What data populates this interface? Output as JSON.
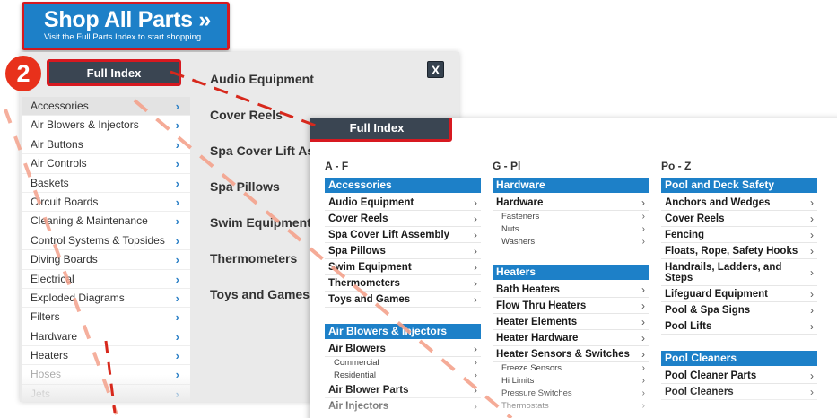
{
  "banner": {
    "title": "Shop All Parts »",
    "subtitle": "Visit the Full Parts Index to start shopping"
  },
  "step_badge": "2",
  "back_panel": {
    "full_index_label": "Full Index",
    "close_label": "X",
    "categories": [
      {
        "label": "Accessories",
        "chevron": "›"
      },
      {
        "label": "Air Blowers & Injectors",
        "chevron": "›"
      },
      {
        "label": "Air Buttons",
        "chevron": "›"
      },
      {
        "label": "Air Controls",
        "chevron": "›"
      },
      {
        "label": "Baskets",
        "chevron": "›"
      },
      {
        "label": "Circuit Boards",
        "chevron": "›"
      },
      {
        "label": "Cleaning & Maintenance",
        "chevron": "›"
      },
      {
        "label": "Control Systems & Topsides",
        "chevron": "›"
      },
      {
        "label": "Diving Boards",
        "chevron": "›"
      },
      {
        "label": "Electrical",
        "chevron": "›"
      },
      {
        "label": "Exploded Diagrams",
        "chevron": "›"
      },
      {
        "label": "Filters",
        "chevron": "›"
      },
      {
        "label": "Hardware",
        "chevron": "›"
      },
      {
        "label": "Heaters",
        "chevron": "›"
      },
      {
        "label": "Hoses",
        "chevron": "›"
      },
      {
        "label": "Jets",
        "chevron": "›"
      }
    ],
    "subcategories": [
      "Audio Equipment",
      "Cover Reels",
      "Spa Cover Lift As",
      "Spa Pillows",
      "Swim Equipment",
      "Thermometers",
      "Toys and Games"
    ]
  },
  "front_panel": {
    "full_index_label": "Full Index",
    "columns": [
      {
        "range": "A - F",
        "groups": [
          {
            "header": "Accessories",
            "rows": [
              {
                "label": "Audio Equipment",
                "child": false
              },
              {
                "label": "Cover Reels",
                "child": false
              },
              {
                "label": "Spa Cover Lift Assembly",
                "child": false
              },
              {
                "label": "Spa Pillows",
                "child": false
              },
              {
                "label": "Swim Equipment",
                "child": false
              },
              {
                "label": "Thermometers",
                "child": false
              },
              {
                "label": "Toys and Games",
                "child": false
              }
            ]
          },
          {
            "header": "Air Blowers & Injectors",
            "rows": [
              {
                "label": "Air Blowers",
                "child": false
              },
              {
                "label": "Commercial",
                "child": true
              },
              {
                "label": "Residential",
                "child": true
              },
              {
                "label": "Air Blower Parts",
                "child": false
              },
              {
                "label": "Air Injectors",
                "child": false
              }
            ]
          }
        ]
      },
      {
        "range": "G - Pl",
        "groups": [
          {
            "header": "Hardware",
            "rows": [
              {
                "label": "Hardware",
                "child": false
              },
              {
                "label": "Fasteners",
                "child": true
              },
              {
                "label": "Nuts",
                "child": true
              },
              {
                "label": "Washers",
                "child": true
              }
            ]
          },
          {
            "header": "Heaters",
            "rows": [
              {
                "label": "Bath Heaters",
                "child": false
              },
              {
                "label": "Flow Thru Heaters",
                "child": false
              },
              {
                "label": "Heater Elements",
                "child": false
              },
              {
                "label": "Heater Hardware",
                "child": false
              },
              {
                "label": "Heater Sensors & Switches",
                "child": false
              },
              {
                "label": "Freeze Sensors",
                "child": true
              },
              {
                "label": "Hi Limits",
                "child": true
              },
              {
                "label": "Pressure Switches",
                "child": true
              },
              {
                "label": "Thermostats",
                "child": true
              }
            ]
          }
        ]
      },
      {
        "range": "Po - Z",
        "groups": [
          {
            "header": "Pool and Deck Safety",
            "rows": [
              {
                "label": "Anchors and Wedges",
                "child": false
              },
              {
                "label": "Cover Reels",
                "child": false
              },
              {
                "label": "Fencing",
                "child": false
              },
              {
                "label": "Floats, Rope, Safety Hooks",
                "child": false
              },
              {
                "label": "Handrails, Ladders, and Steps",
                "child": false
              },
              {
                "label": "Lifeguard Equipment",
                "child": false
              },
              {
                "label": "Pool & Spa Signs",
                "child": false
              },
              {
                "label": "Pool Lifts",
                "child": false
              }
            ]
          },
          {
            "header": "Pool Cleaners",
            "rows": [
              {
                "label": "Pool Cleaner Parts",
                "child": false
              },
              {
                "label": "Pool Cleaners",
                "child": false
              }
            ]
          }
        ]
      }
    ]
  },
  "colors": {
    "accent_blue": "#1d80c8",
    "highlight_red": "#d71920",
    "badge_red": "#e8311b",
    "dark_button": "#3a4552",
    "dash_salmon": "#f4a28c",
    "dash_red": "#d7281c"
  }
}
